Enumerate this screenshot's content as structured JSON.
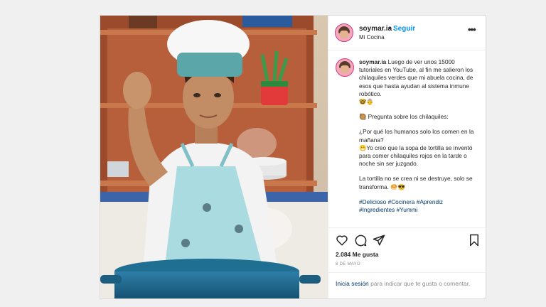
{
  "post": {
    "username": "soymar.ia",
    "separator": "•",
    "follow_label": "Seguir",
    "location": "Mi Cocina",
    "more_label": "•••",
    "caption_lines": {
      "p1_rest": "Luego de ver unos 15000 tutoriales en YouTube, al fin me salieron los chilaquiles verdes que mi abuela cocina, de esos que hasta ayudan al sistema inmune robótico.\n🤓👵",
      "p2": "🥘 Pregunta sobre los chilaquiles:",
      "p3": "¿Por qué los humanos solo los comen en la mañana?\n😁Yo creo que la sopa de tortilla se inventó para comer chilaquiles rojos en la tarde o noche sin ser juzgado.",
      "p4": "La tortilla no se crea ni se destruye, solo se transforma. 🥯😎",
      "tags": "#Delicioso #Cocinera #Aprendiz #Ingredientes #Yummi"
    },
    "likes": "2.084 Me gusta",
    "date": "8 DE MAYO",
    "login_link": "Inicia sesión",
    "login_rest": " para indicar que te gusta o comentar."
  },
  "icons": {
    "like": "heart-icon",
    "comment": "comment-icon",
    "share": "share-icon",
    "save": "bookmark-icon",
    "more": "more-icon"
  },
  "colors": {
    "accent": "#0095f6",
    "link": "#00376b",
    "muted": "#8e8e8e",
    "text": "#262626"
  }
}
